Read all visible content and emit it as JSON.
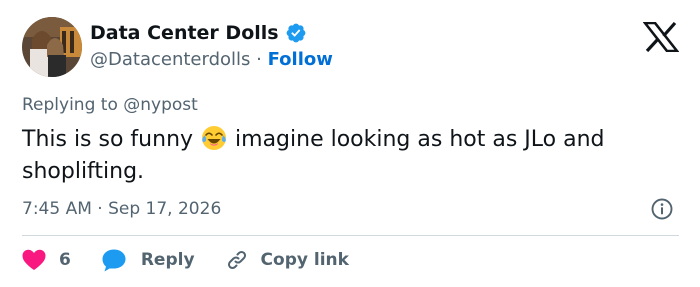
{
  "author": {
    "name": "Data Center Dolls",
    "handle": "@Datacenterdolls",
    "separator": "·",
    "follow_label": "Follow",
    "verified": true
  },
  "icons": {
    "platform_logo": "x-logo-icon",
    "verified": "verified-badge-icon",
    "emoji": "face-with-tears-of-joy-emoji",
    "info": "info-icon",
    "like": "heart-icon",
    "reply": "speech-bubble-icon",
    "copy_link": "link-icon"
  },
  "reply_context": "Replying to @nypost",
  "tweet": {
    "text_before_emoji": "This is so funny ",
    "emoji": "😂",
    "text_after_emoji": " imagine looking as hot as JLo and shoplifting."
  },
  "meta": {
    "time": "7:45 AM",
    "separator": "·",
    "date": "Sep 17, 2026"
  },
  "actions": {
    "like_count": "6",
    "reply_label": "Reply",
    "copy_link_label": "Copy link"
  },
  "colors": {
    "accent_blue": "#1d9bf0",
    "follow_blue": "#006fd6",
    "heart_pink": "#f91880",
    "secondary_text": "#536471",
    "primary_text": "#0f1419",
    "divider": "#cfd9de"
  }
}
